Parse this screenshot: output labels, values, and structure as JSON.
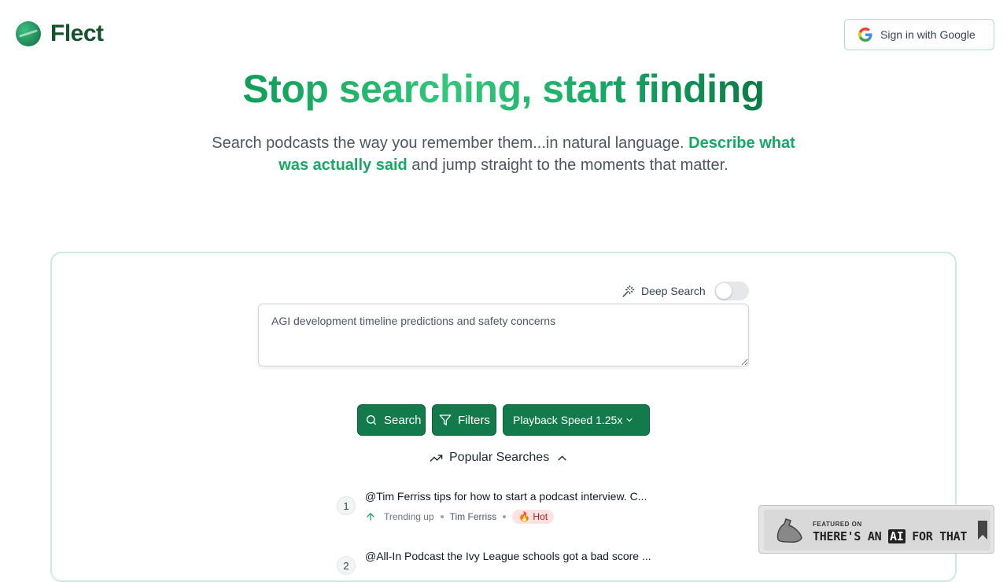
{
  "header": {
    "logo_text": "Flect",
    "signin_label": "Sign in with Google"
  },
  "hero": {
    "title": "Stop searching, start finding",
    "subtitle_pre": "Search podcasts the way you remember them...in natural language. ",
    "subtitle_accent": "Describe what was actually said",
    "subtitle_post": " and jump straight to the moments that matter."
  },
  "search": {
    "deep_search_label": "Deep Search",
    "deep_search_enabled": false,
    "query": "AGI development timeline predictions and safety concerns",
    "search_label": "Search",
    "filters_label": "Filters",
    "speed_label": "Playback Speed 1.25x"
  },
  "popular": {
    "heading": "Popular Searches",
    "items": [
      {
        "rank": "1",
        "title": "@Tim Ferriss tips for how to start a podcast interview. C...",
        "trend": "Trending up",
        "author": "Tim Ferriss",
        "badge": "🔥 Hot"
      },
      {
        "rank": "2",
        "title": "@All-In Podcast the Ivy League schools got a bad score ..."
      }
    ]
  },
  "badge": {
    "featured": "FEATURED ON",
    "pre": "THERE'S AN ",
    "ai": "AI",
    "post": " FOR THAT"
  },
  "colors": {
    "brand_green": "#127a4b",
    "accent_green": "#16a864",
    "hot_bg": "#fee2e2"
  }
}
